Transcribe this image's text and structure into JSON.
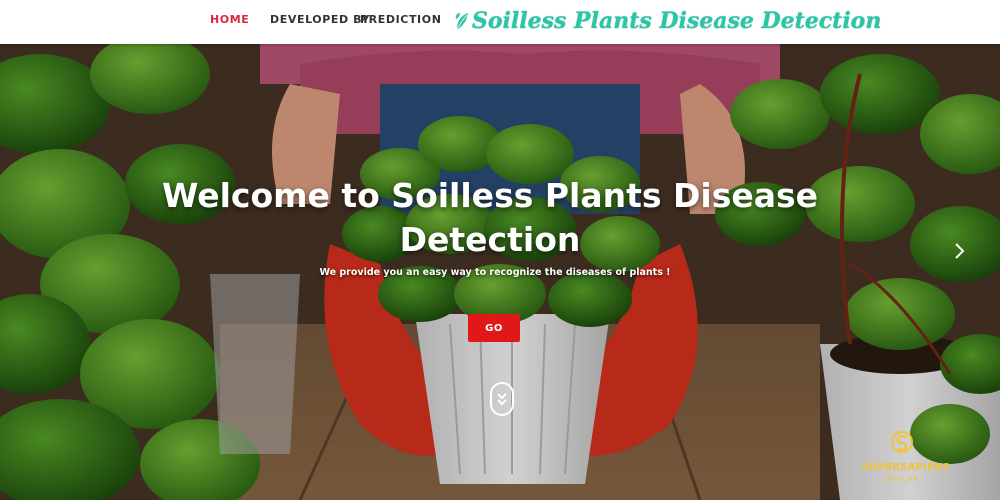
{
  "navbar": {
    "items": [
      {
        "label": "HOME",
        "active": true
      },
      {
        "label": "DEVELOPED BY",
        "active": false
      },
      {
        "label": "PREDICTION",
        "active": false
      }
    ],
    "brand": "Soilless Plants Disease Detection",
    "brand_icon": "leaf-icon"
  },
  "hero": {
    "title": "Welcome to Soilless Plants Disease Detection",
    "subtitle": "We provide you an easy way to recognize the diseases of plants !",
    "go_label": "GO",
    "scroll_icon": "double-chevron-down-icon",
    "next_icon": "chevron-right-icon"
  },
  "logo": {
    "name": "SUPERSAPIENS",
    "sub": "DEVLAB"
  },
  "colors": {
    "active_nav": "#d7263d",
    "brand": "#2ec4a6",
    "go_button": "#e01818",
    "logo": "#f2c233"
  }
}
